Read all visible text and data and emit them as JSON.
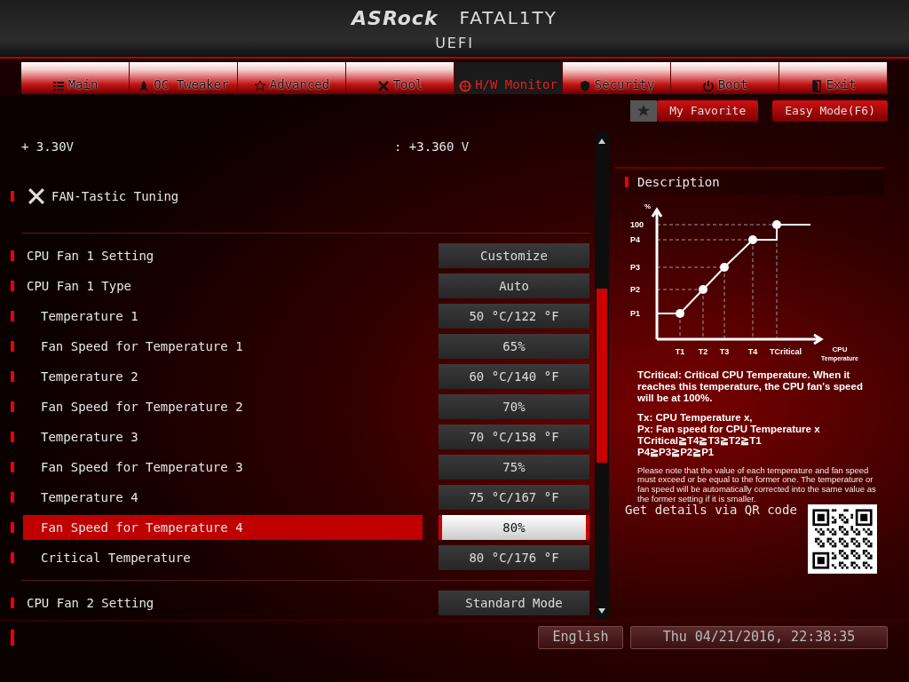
{
  "header": {
    "brand": "ASRock",
    "series": "FATAL1TY",
    "subtitle": "UEFI"
  },
  "tabs": [
    {
      "label": "Main",
      "selected": false
    },
    {
      "label": "OC Tweaker",
      "selected": false
    },
    {
      "label": "Advanced",
      "selected": false
    },
    {
      "label": "Tool",
      "selected": false
    },
    {
      "label": "H/W Monitor",
      "selected": true
    },
    {
      "label": "Security",
      "selected": false
    },
    {
      "label": "Boot",
      "selected": false
    },
    {
      "label": "Exit",
      "selected": false
    }
  ],
  "favorite_button": "My Favorite",
  "easy_mode_button": "Easy Mode(F6)",
  "voltage": {
    "label": "+ 3.30V",
    "value": ": +3.360 V"
  },
  "section_title": "FAN-Tastic Tuning",
  "setting_groups": [
    [
      {
        "label": "CPU Fan 1 Setting",
        "value": "Customize",
        "selected": false
      },
      {
        "label": "CPU Fan 1 Type",
        "value": "Auto",
        "selected": false,
        "children": [
          {
            "label": "Temperature 1",
            "value": "50 °C/122 °F",
            "selected": false
          },
          {
            "label": "Fan Speed for Temperature 1",
            "value": "65%",
            "selected": false
          },
          {
            "label": "Temperature 2",
            "value": "60 °C/140 °F",
            "selected": false
          },
          {
            "label": "Fan Speed for Temperature 2",
            "value": "70%",
            "selected": false
          },
          {
            "label": "Temperature 3",
            "value": "70 °C/158 °F",
            "selected": false
          },
          {
            "label": "Fan Speed for Temperature 3",
            "value": "75%",
            "selected": false
          },
          {
            "label": "Temperature 4",
            "value": "75 °C/167 °F",
            "selected": false
          },
          {
            "label": "Fan Speed for Temperature 4",
            "value": "80%",
            "selected": true
          },
          {
            "label": "Critical Temperature",
            "value": "80 °C/176 °F",
            "selected": false
          }
        ]
      }
    ],
    [
      {
        "label": "CPU Fan 2 Setting",
        "value": "Standard Mode",
        "selected": false
      }
    ]
  ],
  "description": {
    "title": "Description",
    "diagram_labels": {
      "y_axis": "%",
      "levels": [
        "100",
        "P4",
        "P3",
        "P2",
        "P1"
      ],
      "temps": [
        "T1",
        "T2",
        "T3",
        "T4",
        "TCritical"
      ],
      "x_axis": "CPU",
      "x_axis_sub": "Temperature"
    },
    "paragraphs": [
      "TCritical: Critical CPU Temperature. When it reaches this temperature, the CPU fan's speed will be at 100%."
    ],
    "definitions": [
      "Tx: CPU Temperature x,",
      "Px: Fan speed for CPU Temperature x",
      "TCritical≧T4≧T3≧T2≧T1",
      "P4≧P3≧P2≧P1"
    ],
    "note": "Please note that the value of each temperature and fan speed must exceed or be equal to the former one. The temperature or fan speed will be automatically corrected into the same value as the former setting if it is smaller.",
    "qr_label": "Get details via QR code"
  },
  "status_bar": {
    "language": "English",
    "datetime": "Thu 04/21/2016, 22:38:35"
  }
}
